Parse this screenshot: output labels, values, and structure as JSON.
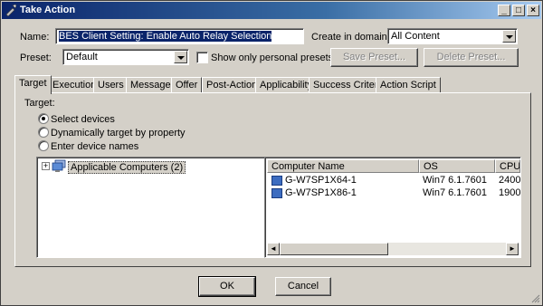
{
  "window": {
    "title": "Take Action"
  },
  "controls": {
    "minimize": "_",
    "maximize": "□",
    "close": "×"
  },
  "form": {
    "name_label": "Name:",
    "name_value": "BES Client Setting: Enable Auto Relay Selection",
    "domain_label": "Create in domain:",
    "domain_value": "All Content",
    "preset_label": "Preset:",
    "preset_value": "Default",
    "personal_presets_label": "Show only personal presets",
    "save_preset": "Save Preset...",
    "delete_preset": "Delete Preset..."
  },
  "tabs": [
    "Target",
    "Execution",
    "Users",
    "Messages",
    "Offer",
    "Post-Action",
    "Applicability",
    "Success Criteria",
    "Action Script"
  ],
  "target": {
    "heading": "Target:",
    "options": [
      "Select devices",
      "Dynamically target by property",
      "Enter device names"
    ],
    "selected_option": 0,
    "tree_root": "Applicable Computers (2)",
    "tree_expander": "+"
  },
  "computers": {
    "columns": [
      "Computer Name",
      "OS",
      "CPU"
    ],
    "rows": [
      [
        "G-W7SP1X64-1",
        "Win7 6.1.7601",
        "2400"
      ],
      [
        "G-W7SP1X86-1",
        "Win7 6.1.7601",
        "1900"
      ]
    ]
  },
  "scroll": {
    "left": "◄",
    "right": "►"
  },
  "buttons": {
    "ok": "OK",
    "cancel": "Cancel"
  },
  "colors": {
    "title_start": "#0a246a",
    "title_end": "#a6caf0",
    "face": "#d4d0c8",
    "selection": "#0a246a"
  },
  "icons": [
    "app-icon",
    "computer-group-icon",
    "computer-icon",
    "dropdown-arrow-icon"
  ]
}
